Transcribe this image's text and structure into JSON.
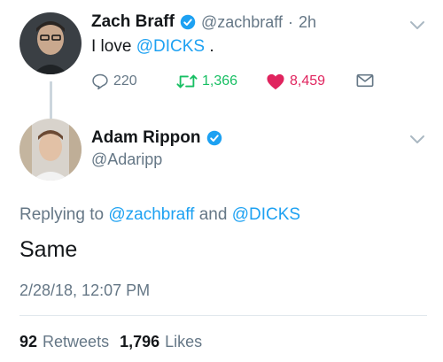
{
  "parent_tweet": {
    "display_name": "Zach Braff",
    "handle": "@zachbraff",
    "separator": "·",
    "time": "2h",
    "text_prefix": "I love ",
    "mention": "@DICKS",
    "text_suffix": " .",
    "replies": "220",
    "retweets": "1,366",
    "likes": "8,459"
  },
  "reply_tweet": {
    "display_name": "Adam Rippon",
    "handle": "@Adaripp",
    "replying_prefix": "Replying to ",
    "replying_user1": "@zachbraff",
    "replying_and": " and ",
    "replying_user2": "@DICKS",
    "text": "Same",
    "timestamp": "2/28/18, 12:07 PM",
    "retweet_count": "92",
    "retweet_label": "Retweets",
    "like_count": "1,796",
    "like_label": "Likes"
  },
  "colors": {
    "link": "#1da1f2",
    "muted": "#657786",
    "retweet_green": "#17bf63",
    "like_red": "#e0245e",
    "verified_blue": "#1da1f2"
  },
  "icons": [
    "verified-badge-icon",
    "chevron-down-icon",
    "reply-icon",
    "retweet-icon",
    "heart-icon",
    "direct-message-icon"
  ]
}
